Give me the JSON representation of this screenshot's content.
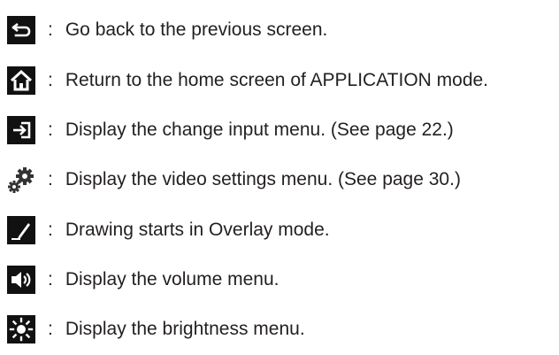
{
  "legend": {
    "separator": ":",
    "items": [
      {
        "icon": "back-arrow-icon",
        "text": "Go back to the previous screen."
      },
      {
        "icon": "home-icon",
        "text": "Return to the home screen of APPLICATION mode."
      },
      {
        "icon": "input-icon",
        "text": "Display the change input menu. (See page 22.)"
      },
      {
        "icon": "settings-gears-icon",
        "text": "Display the video settings menu. (See page 30.)"
      },
      {
        "icon": "pen-icon",
        "text": "Drawing starts in Overlay mode."
      },
      {
        "icon": "volume-icon",
        "text": "Display the volume menu."
      },
      {
        "icon": "brightness-icon",
        "text": "Display the brightness menu."
      }
    ]
  }
}
